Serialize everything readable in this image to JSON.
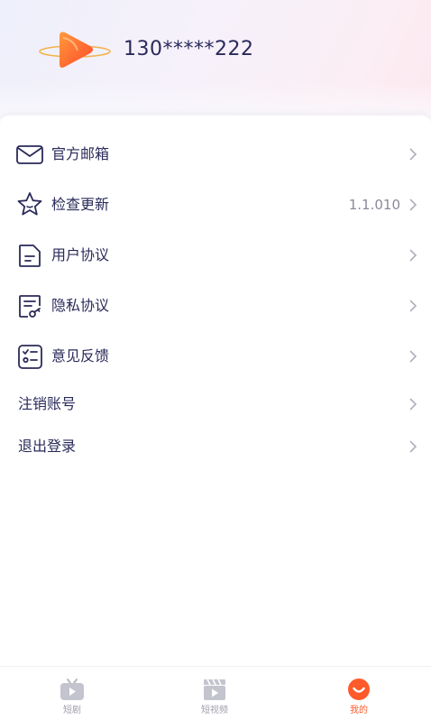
{
  "profile": {
    "phone": "130*****222"
  },
  "menu": [
    {
      "label": "官方邮箱",
      "value": "",
      "icon": "mail-icon"
    },
    {
      "label": "检查更新",
      "value": "1.1.010",
      "icon": "star-icon"
    },
    {
      "label": "用户协议",
      "value": "",
      "icon": "document-icon"
    },
    {
      "label": "隐私协议",
      "value": "",
      "icon": "privacy-doc-icon"
    },
    {
      "label": "意见反馈",
      "value": "",
      "icon": "feedback-icon"
    },
    {
      "label": "注销账号",
      "value": "",
      "icon": ""
    },
    {
      "label": "退出登录",
      "value": "",
      "icon": ""
    }
  ],
  "tabs": [
    {
      "label": "短剧",
      "icon": "tv-icon",
      "active": false
    },
    {
      "label": "短视频",
      "icon": "video-icon",
      "active": false
    },
    {
      "label": "我的",
      "icon": "smile-icon",
      "active": true
    }
  ],
  "colors": {
    "accent": "#ff5a2a",
    "text": "#2a2a5a",
    "muted": "#8a8a9a"
  }
}
